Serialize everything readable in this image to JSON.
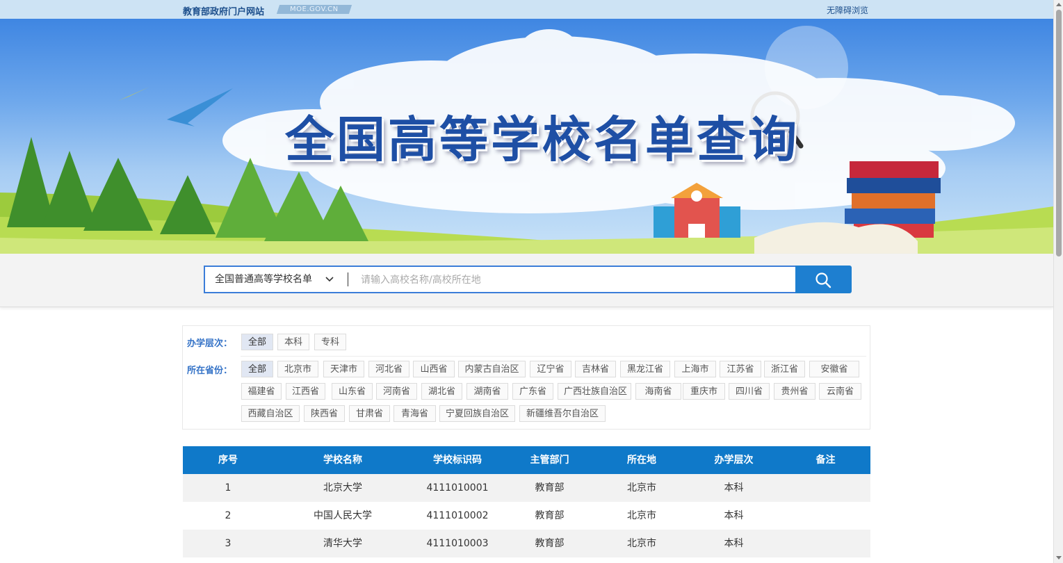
{
  "topbar": {
    "site_name": "教育部政府门户网站",
    "site_domain": "MOE.GOV.CN",
    "accessible_link": "无障碍浏览"
  },
  "banner": {
    "title": "全国高等学校名单查询"
  },
  "search": {
    "list_selected": "全国普通高等学校名单",
    "placeholder": "请输入高校名称/高校所在地"
  },
  "filters": {
    "level_label": "办学层次：",
    "levels": [
      "全部",
      "本科",
      "专科"
    ],
    "province_label": "所在省份：",
    "provinces": [
      "全部",
      "北京市",
      "天津市",
      "河北省",
      "山西省",
      "内蒙古自治区",
      "辽宁省",
      "吉林省",
      "黑龙江省",
      "上海市",
      "江苏省",
      "浙江省",
      "安徽省",
      "福建省",
      "江西省",
      "山东省",
      "河南省",
      "湖北省",
      "湖南省",
      "广东省",
      "广西壮族自治区",
      "海南省",
      "重庆市",
      "四川省",
      "贵州省",
      "云南省",
      "西藏自治区",
      "陕西省",
      "甘肃省",
      "青海省",
      "宁夏回族自治区",
      "新疆维吾尔自治区"
    ]
  },
  "table": {
    "headers": [
      "序号",
      "学校名称",
      "学校标识码",
      "主管部门",
      "所在地",
      "办学层次",
      "备注"
    ],
    "rows": [
      [
        "1",
        "北京大学",
        "4111010001",
        "教育部",
        "北京市",
        "本科",
        ""
      ],
      [
        "2",
        "中国人民大学",
        "4111010002",
        "教育部",
        "北京市",
        "本科",
        ""
      ],
      [
        "3",
        "清华大学",
        "4111010003",
        "教育部",
        "北京市",
        "本科",
        ""
      ]
    ]
  },
  "colors": {
    "accent": "#1e7fd0",
    "table_header": "#0f79c9",
    "label_blue": "#3573c7"
  }
}
